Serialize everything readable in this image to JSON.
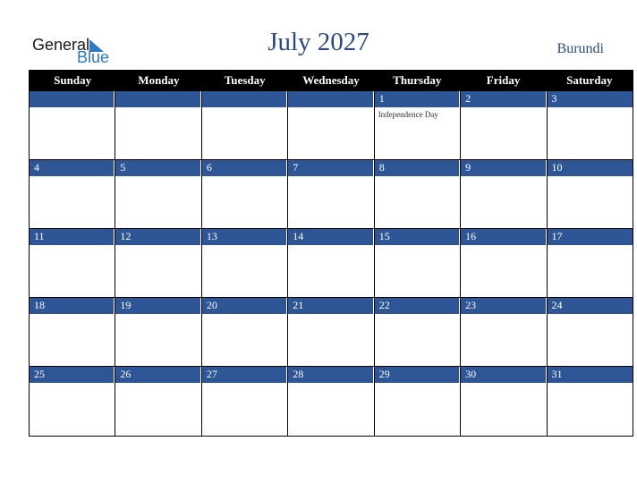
{
  "logo": {
    "word1": "General",
    "word2": "Blue"
  },
  "title": "July 2027",
  "country": "Burundi",
  "colors": {
    "accent": "#2e5596",
    "title": "#2c4a7c",
    "logo_blue": "#2a7bc0"
  },
  "weekdays": [
    "Sunday",
    "Monday",
    "Tuesday",
    "Wednesday",
    "Thursday",
    "Friday",
    "Saturday"
  ],
  "weeks": [
    [
      {
        "day": ""
      },
      {
        "day": ""
      },
      {
        "day": ""
      },
      {
        "day": ""
      },
      {
        "day": "1",
        "event": "Independence Day"
      },
      {
        "day": "2"
      },
      {
        "day": "3"
      }
    ],
    [
      {
        "day": "4"
      },
      {
        "day": "5"
      },
      {
        "day": "6"
      },
      {
        "day": "7"
      },
      {
        "day": "8"
      },
      {
        "day": "9"
      },
      {
        "day": "10"
      }
    ],
    [
      {
        "day": "11"
      },
      {
        "day": "12"
      },
      {
        "day": "13"
      },
      {
        "day": "14"
      },
      {
        "day": "15"
      },
      {
        "day": "16"
      },
      {
        "day": "17"
      }
    ],
    [
      {
        "day": "18"
      },
      {
        "day": "19"
      },
      {
        "day": "20"
      },
      {
        "day": "21"
      },
      {
        "day": "22"
      },
      {
        "day": "23"
      },
      {
        "day": "24"
      }
    ],
    [
      {
        "day": "25"
      },
      {
        "day": "26"
      },
      {
        "day": "27"
      },
      {
        "day": "28"
      },
      {
        "day": "29"
      },
      {
        "day": "30"
      },
      {
        "day": "31"
      }
    ]
  ]
}
